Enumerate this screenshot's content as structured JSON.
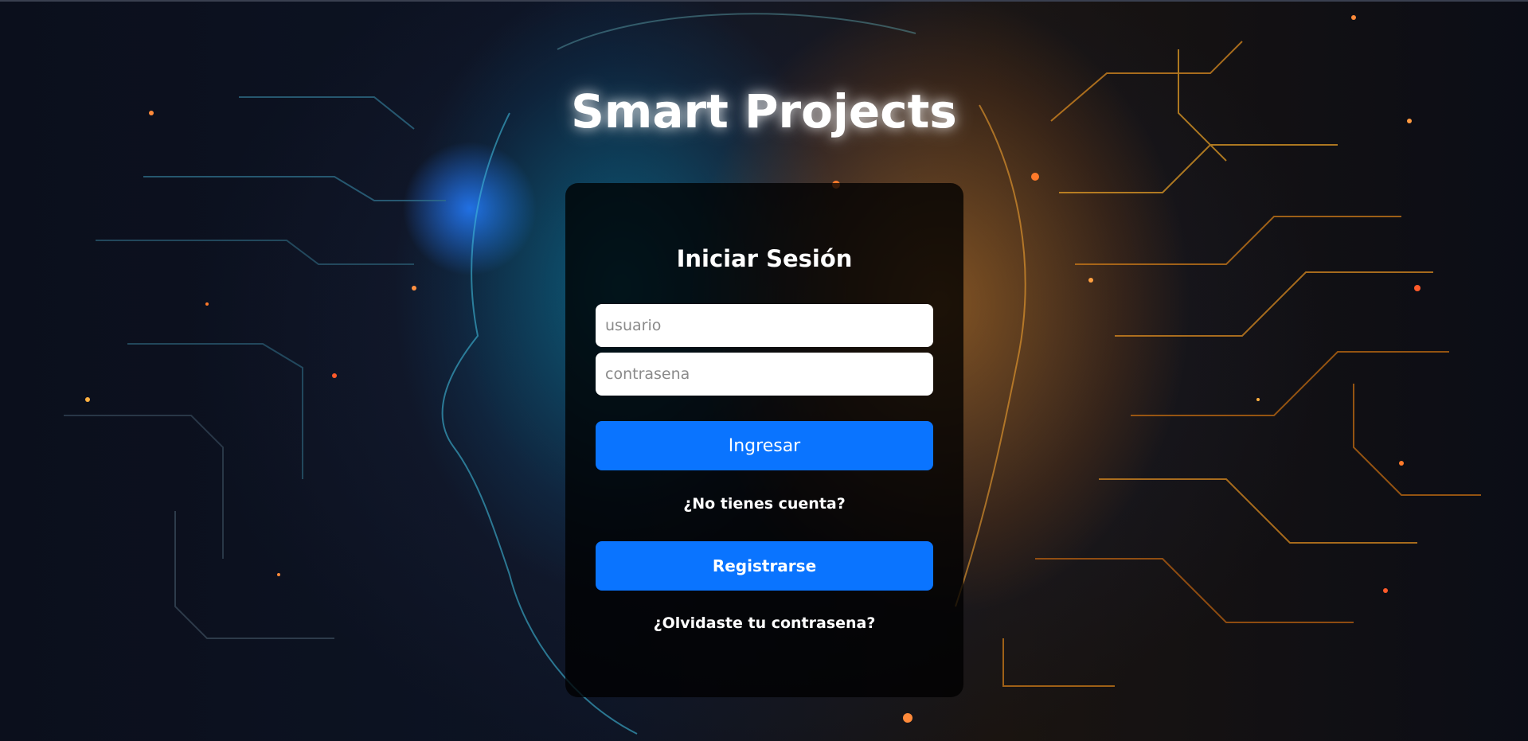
{
  "page": {
    "brand_title": "Smart Projects"
  },
  "login_card": {
    "title": "Iniciar Sesión",
    "username_placeholder": "usuario",
    "password_placeholder": "contrasena",
    "login_button": "Ingresar",
    "no_account_text": "¿No tienes cuenta?",
    "register_button": "Registrarse",
    "forgot_password_link": "¿Olvidaste tu contrasena?"
  },
  "colors": {
    "primary_button": "#0a74ff",
    "card_background": "rgba(0,0,0,0.78)",
    "text": "#ffffff"
  }
}
